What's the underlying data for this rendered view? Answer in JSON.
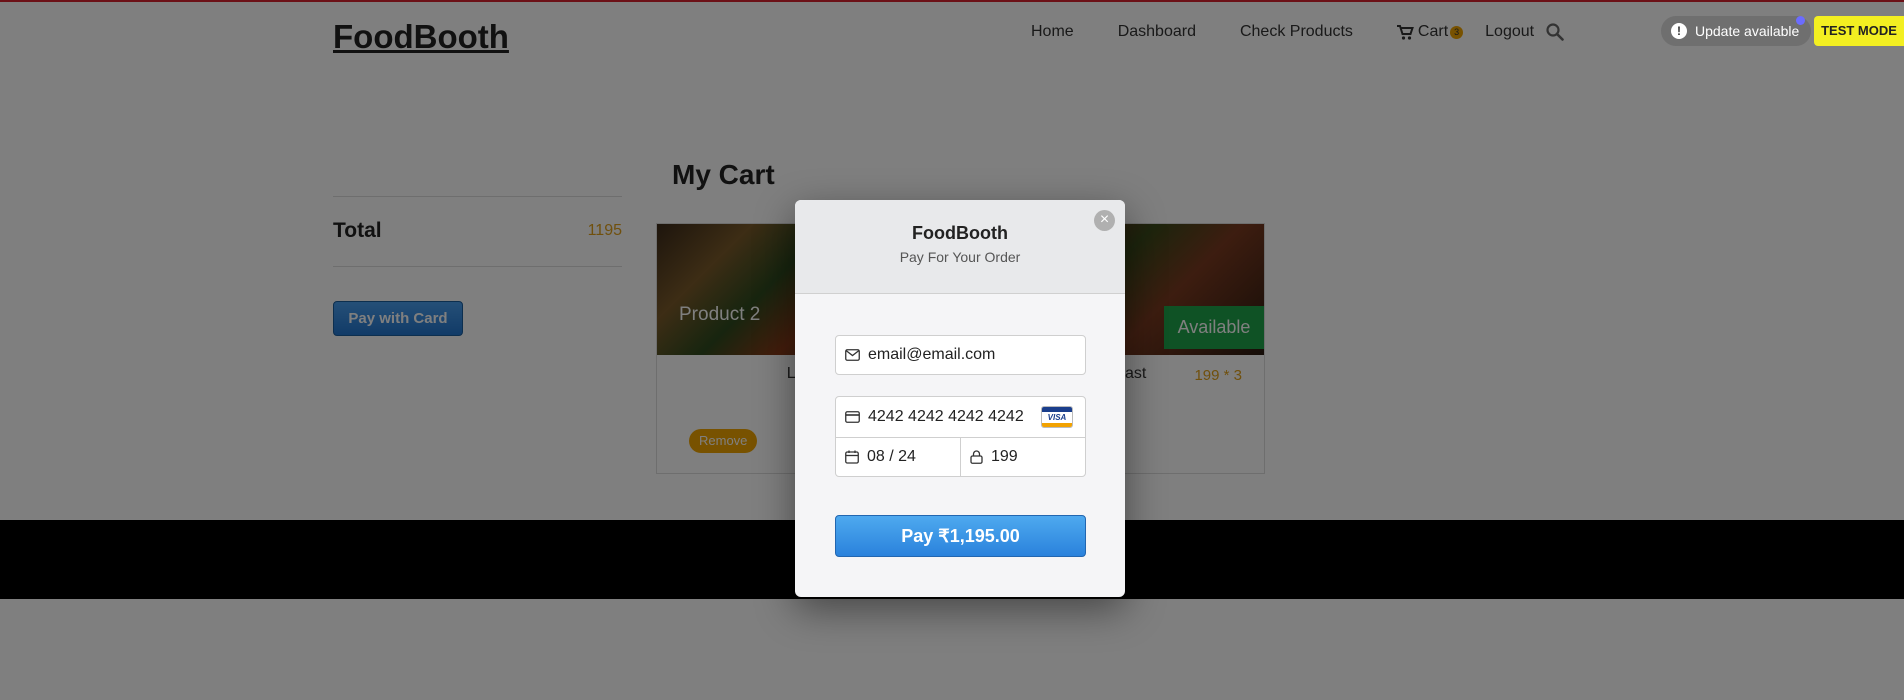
{
  "header": {
    "brand": "FoodBooth",
    "nav": {
      "home": "Home",
      "dashboard": "Dashboard",
      "check_products": "Check Products",
      "cart": "Cart",
      "cart_count": "3",
      "logout": "Logout"
    },
    "update_label": "Update available",
    "test_mode": "TEST MODE"
  },
  "sidebar": {
    "total_label": "Total",
    "total_value": "1195",
    "pay_button": "Pay with Card"
  },
  "main": {
    "title": "My Cart",
    "items": [
      {
        "name": "Product 2",
        "category": "Lunch",
        "remove": "Remove"
      },
      {
        "category": "Breakfast",
        "price": "199 * 3",
        "status": "Available"
      }
    ]
  },
  "modal": {
    "title": "FoodBooth",
    "subtitle": "Pay For Your Order",
    "email": "email@email.com",
    "card_number": "4242 4242 4242 4242",
    "expiry": "08 / 24",
    "cvc": "199",
    "pay_button": "Pay ₹1,195.00",
    "close": "×"
  },
  "colors": {
    "accent_blue": "#2a82dc",
    "price_orange": "#e0a01a",
    "available_green": "#1ea54a",
    "test_mode_yellow": "#f3ef21"
  }
}
